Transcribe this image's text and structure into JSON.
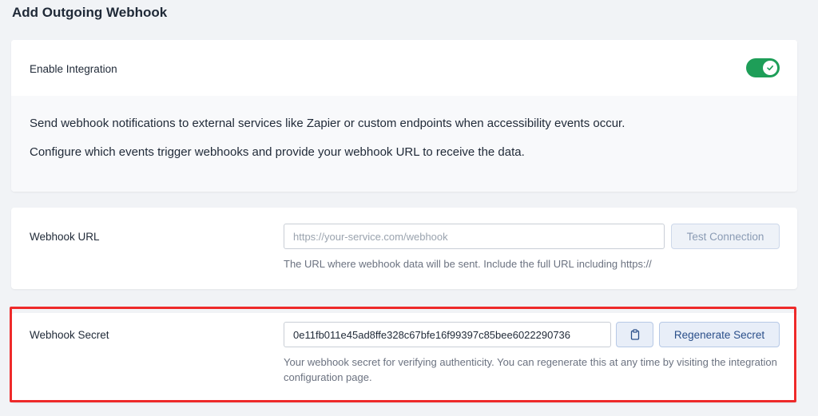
{
  "page": {
    "title": "Add Outgoing Webhook"
  },
  "integration": {
    "enable_label": "Enable Integration",
    "enabled": true,
    "toggle_color": "#1e9e58",
    "description_1": "Send webhook notifications to external services like Zapier or custom endpoints when accessibility events occur.",
    "description_2": "Configure which events trigger webhooks and provide your webhook URL to receive the data."
  },
  "webhook_url": {
    "label": "Webhook URL",
    "value": "",
    "placeholder": "https://your-service.com/webhook",
    "test_button_label": "Test Connection",
    "help": "The URL where webhook data will be sent. Include the full URL including https://"
  },
  "webhook_secret": {
    "label": "Webhook Secret",
    "value": "0e11fb011e45ad8ffe328c67bfe16f99397c85bee6022290736",
    "copy_icon": "clipboard-icon",
    "regenerate_button_label": "Regenerate Secret",
    "help": "Your webhook secret for verifying authenticity. You can regenerate this at any time by visiting the integration configuration page.",
    "highlight_color": "#ee2a2a"
  }
}
